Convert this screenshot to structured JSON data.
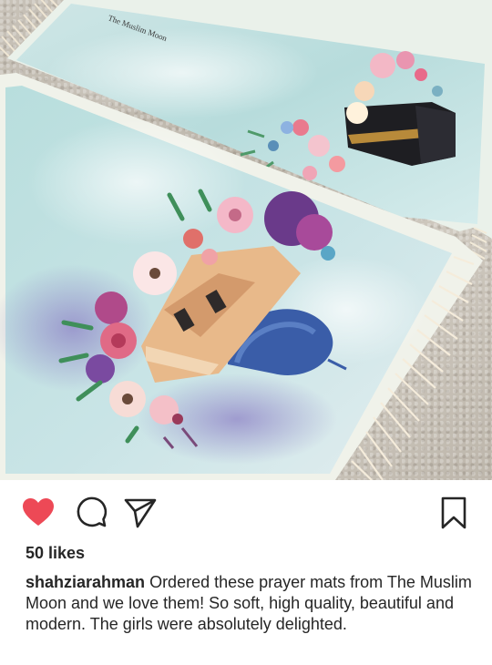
{
  "post": {
    "likes_label": "50 likes",
    "username": "shahziarahman",
    "caption_text": "Ordered these prayer mats from The Muslim Moon and we love them! So soft, high quality, beautiful and modern. The girls were absolutely delighted.",
    "liked": true,
    "mat_logo_text": "The Muslim Moon"
  },
  "icons": {
    "like": "heart-icon",
    "comment": "comment-icon",
    "share": "send-icon",
    "save": "bookmark-icon"
  },
  "colors": {
    "heart": "#ed4956",
    "text": "#262626",
    "icon": "#262626"
  }
}
